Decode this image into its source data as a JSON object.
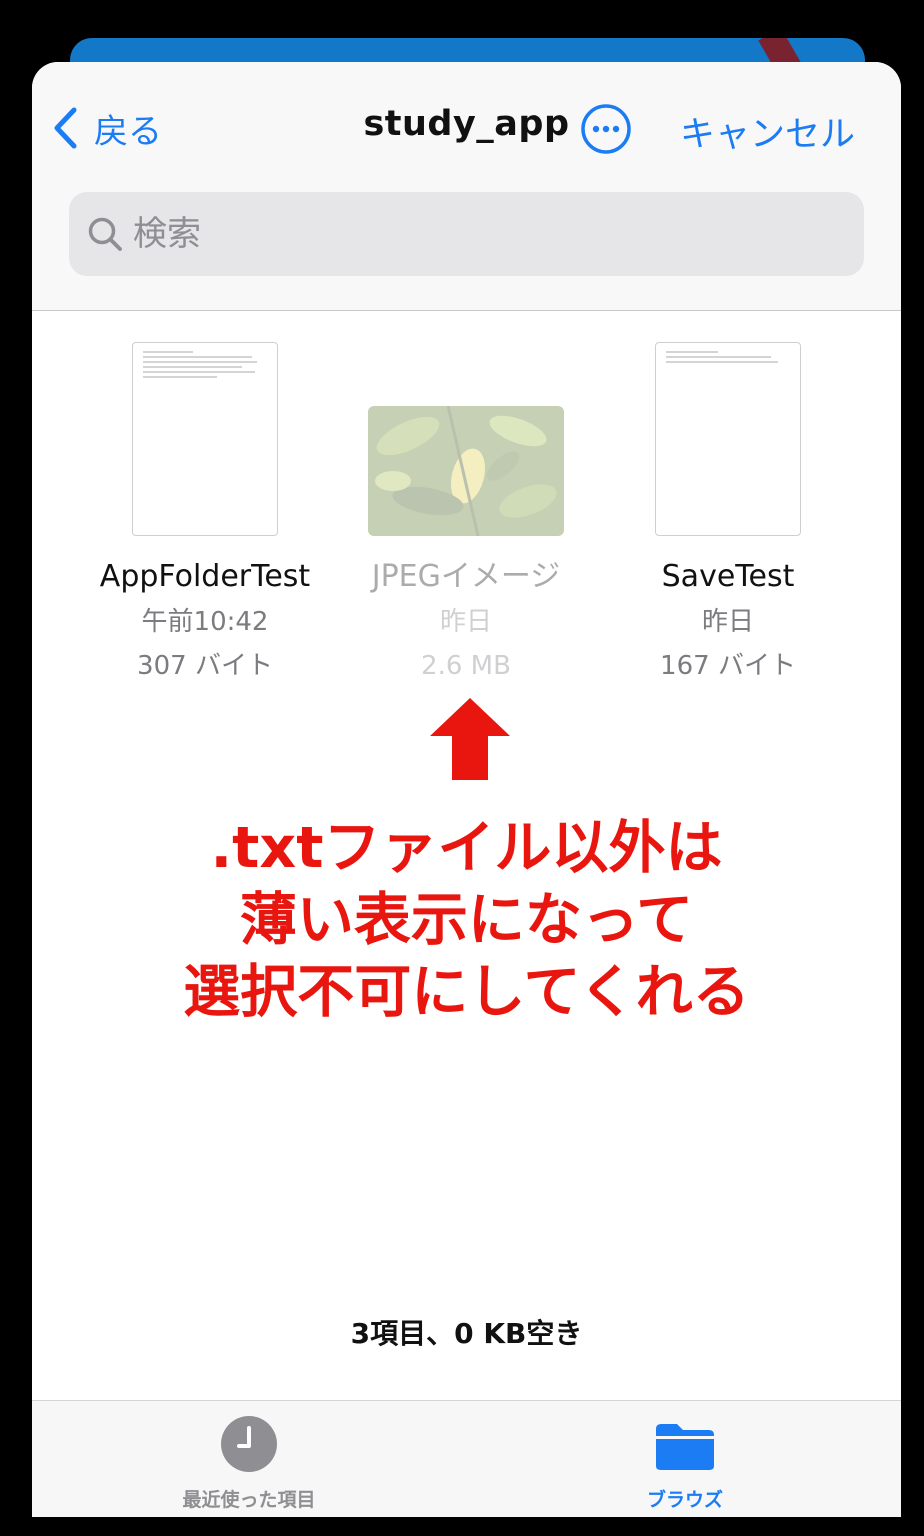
{
  "navbar": {
    "back_label": "戻る",
    "title": "study_app",
    "cancel_label": "キャンセル"
  },
  "search": {
    "placeholder": "検索"
  },
  "files": [
    {
      "name": "AppFolderTest",
      "date": "午前10:42",
      "size": "307 バイト",
      "enabled": true
    },
    {
      "name": "JPEGイメージ",
      "date": "昨日",
      "size": "2.6 MB",
      "enabled": false
    },
    {
      "name": "SaveTest",
      "date": "昨日",
      "size": "167 バイト",
      "enabled": true
    }
  ],
  "annotation": {
    "lines": [
      ".txtファイル以外は",
      "薄い表示になって",
      "選択不可にしてくれる"
    ],
    "color": "#e8160f"
  },
  "footer": {
    "count_text": "3項目、0 KB空き"
  },
  "tabs": [
    {
      "label": "最近使った項目",
      "icon": "clock-icon",
      "selected": false
    },
    {
      "label": "ブラウズ",
      "icon": "folder-icon",
      "selected": true
    }
  ],
  "colors": {
    "accent": "#1b7cf3",
    "tab_inactive": "#8e8e93"
  }
}
